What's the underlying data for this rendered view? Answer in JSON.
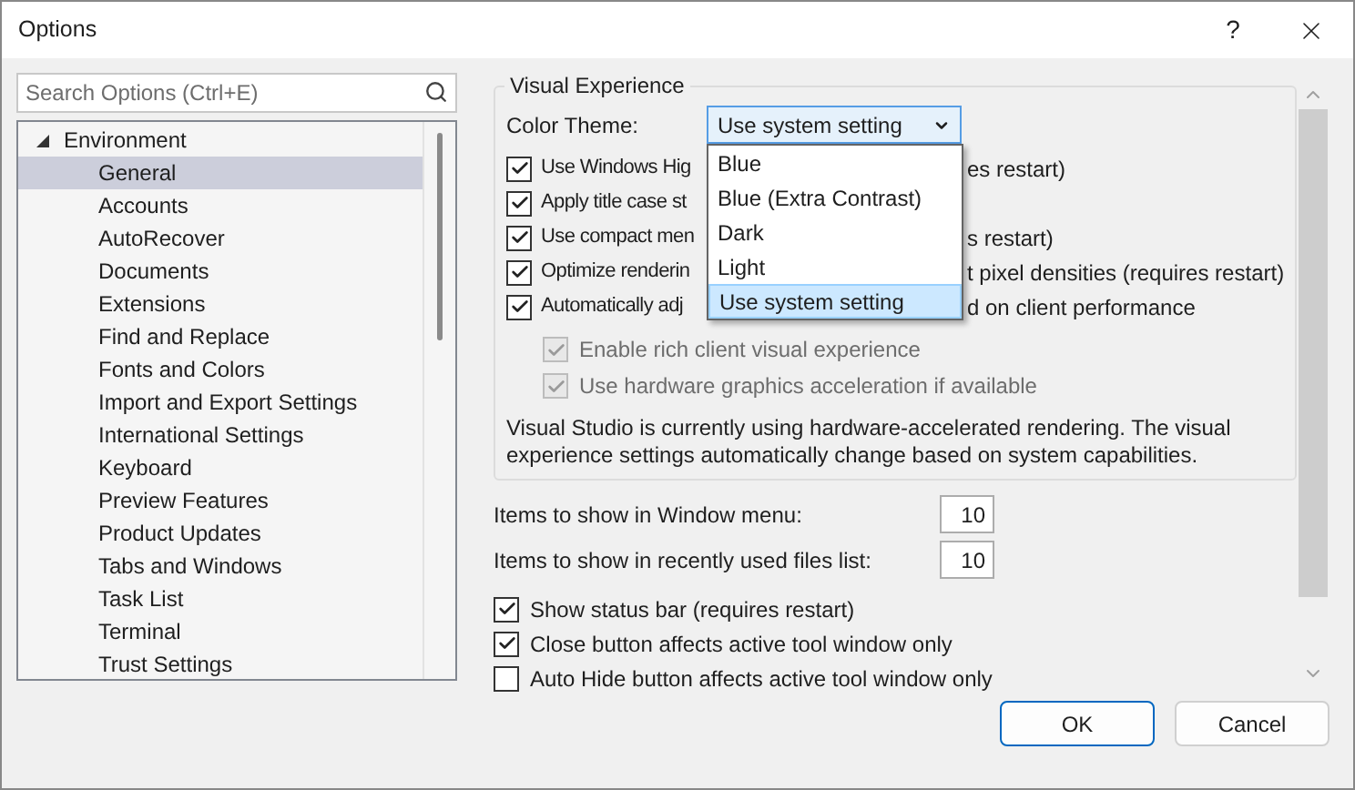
{
  "window": {
    "title": "Options",
    "help": "?"
  },
  "search": {
    "placeholder": "Search Options (Ctrl+E)"
  },
  "tree": [
    {
      "label": "Environment",
      "expanded": true,
      "children": [
        {
          "label": "General",
          "selected": true
        },
        {
          "label": "Accounts",
          "selected": false
        },
        {
          "label": "AutoRecover",
          "selected": false
        },
        {
          "label": "Documents",
          "selected": false
        },
        {
          "label": "Extensions",
          "selected": false
        },
        {
          "label": "Find and Replace",
          "selected": false
        },
        {
          "label": "Fonts and Colors",
          "selected": false
        },
        {
          "label": "Import and Export Settings",
          "selected": false
        },
        {
          "label": "International Settings",
          "selected": false
        },
        {
          "label": "Keyboard",
          "selected": false
        },
        {
          "label": "Preview Features",
          "selected": false
        },
        {
          "label": "Product Updates",
          "selected": false
        },
        {
          "label": "Tabs and Windows",
          "selected": false
        },
        {
          "label": "Task List",
          "selected": false
        },
        {
          "label": "Terminal",
          "selected": false
        },
        {
          "label": "Trust Settings",
          "selected": false
        }
      ]
    }
  ],
  "visual_experience": {
    "title": "Visual Experience",
    "color_theme": {
      "label": "Color Theme:",
      "value": "Use system setting",
      "expanded": true,
      "options": [
        {
          "label": "Blue",
          "selected": false
        },
        {
          "label": "Blue (Extra Contrast)",
          "selected": false
        },
        {
          "label": "Dark",
          "selected": false
        },
        {
          "label": "Light",
          "selected": false
        },
        {
          "label": "Use system setting",
          "selected": true
        }
      ]
    },
    "options": [
      {
        "label_left": "Use Windows Hig",
        "label_right": "es restart)",
        "checked": true
      },
      {
        "label_left": "Apply title case st",
        "checked": true
      },
      {
        "label_left": "Use compact men",
        "label_right": "s restart)",
        "checked": true
      },
      {
        "label_left": "Optimize renderin",
        "label_right": "t pixel densities (requires restart)",
        "checked": true
      },
      {
        "label_left": "Automatically adj",
        "label_right": "d on client performance",
        "checked": true,
        "children": [
          {
            "label": "Enable rich client visual experience",
            "checked": true,
            "disabled": true
          },
          {
            "label": "Use hardware graphics acceleration if available",
            "checked": true,
            "disabled": true
          }
        ]
      }
    ],
    "note": "Visual Studio is currently using hardware-accelerated rendering. The visual experience settings automatically change based on system capabilities."
  },
  "number_fields": [
    {
      "label": "Items to show in Window menu:",
      "value": "10"
    },
    {
      "label": "Items to show in recently used files list:",
      "value": "10"
    }
  ],
  "checkboxes": [
    {
      "label": "Show status bar (requires restart)",
      "checked": true
    },
    {
      "label": "Close button affects active tool window only",
      "checked": true
    },
    {
      "label": "Auto Hide button affects active tool window only",
      "checked": false
    }
  ],
  "buttons": [
    {
      "label": "OK",
      "default": true
    },
    {
      "label": "Cancel",
      "default": false
    }
  ]
}
